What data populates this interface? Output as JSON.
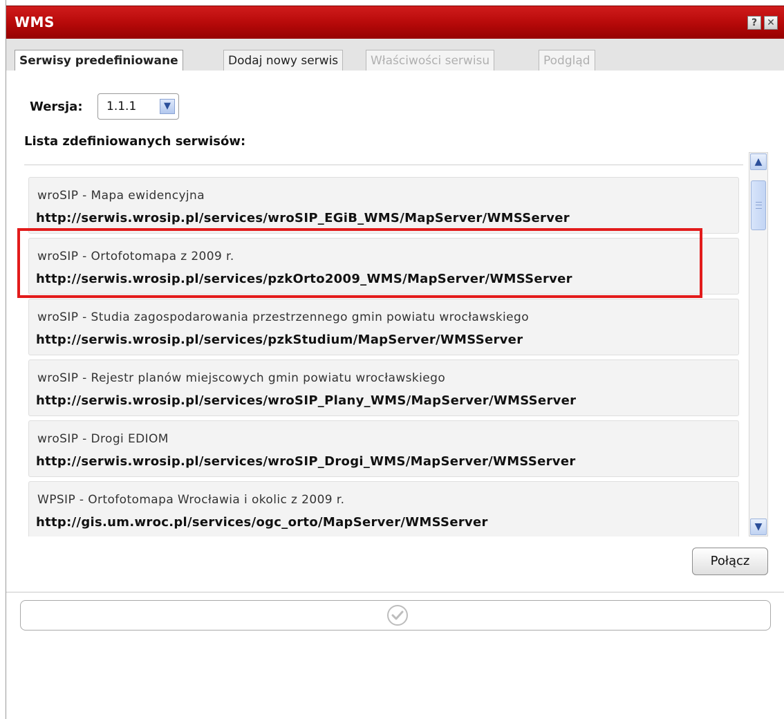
{
  "window": {
    "title": "WMS",
    "help_icon": "help-icon",
    "close_icon": "close-icon"
  },
  "tabs": [
    {
      "label": "Serwisy predefiniowane",
      "state": "active"
    },
    {
      "label": "Dodaj nowy serwis",
      "state": "enabled"
    },
    {
      "label": "Właściwości serwisu",
      "state": "disabled"
    },
    {
      "label": "Podgląd",
      "state": "disabled"
    }
  ],
  "version": {
    "label": "Wersja:",
    "selected": "1.1.1"
  },
  "services": {
    "list_label": "Lista zdefiniowanych serwisów:",
    "items": [
      {
        "name": "wroSIP - Mapa ewidencyjna",
        "url": "http://serwis.wrosip.pl/services/wroSIP_EGiB_WMS/MapServer/WMSServer"
      },
      {
        "name": "wroSIP - Ortofotomapa z 2009 r.",
        "url": "http://serwis.wrosip.pl/services/pzkOrto2009_WMS/MapServer/WMSServer"
      },
      {
        "name": "wroSIP - Studia zagospodarowania przestrzennego gmin powiatu wrocławskiego",
        "url": "http://serwis.wrosip.pl/services/pzkStudium/MapServer/WMSServer"
      },
      {
        "name": "wroSIP - Rejestr planów miejscowych gmin powiatu wrocławskiego",
        "url": "http://serwis.wrosip.pl/services/wroSIP_Plany_WMS/MapServer/WMSServer"
      },
      {
        "name": "wroSIP - Drogi EDIOM",
        "url": "http://serwis.wrosip.pl/services/wroSIP_Drogi_WMS/MapServer/WMSServer"
      },
      {
        "name": "WPSIP - Ortofotomapa Wrocławia i okolic z 2009 r.",
        "url": "http://gis.um.wroc.pl/services/ogc_orto/MapServer/WMSServer"
      }
    ],
    "highlight_color": "#e21b1b"
  },
  "connect_button": {
    "label": "Połącz"
  },
  "status": {
    "icon": "checkmark-circle-icon"
  },
  "colors": {
    "title_bar": "#b80a0a"
  }
}
